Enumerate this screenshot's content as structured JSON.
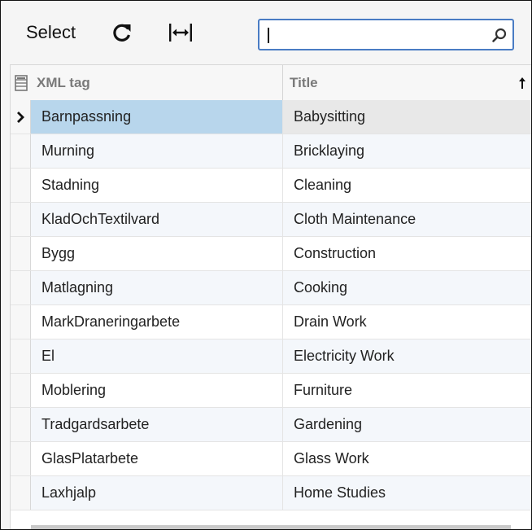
{
  "toolbar": {
    "select_label": "Select",
    "refresh_icon": "refresh-icon",
    "fit_columns_icon": "fit-columns-icon"
  },
  "search": {
    "value": "",
    "placeholder": "",
    "icon": "search-icon",
    "border_color": "#4a7cc4"
  },
  "grid": {
    "columns": [
      {
        "key": "xml_tag",
        "label": "XML tag"
      },
      {
        "key": "title",
        "label": "Title",
        "sorted": "ascending"
      }
    ],
    "column_chooser_icon": "column-chooser-icon",
    "selected_row": 0,
    "selection_color": "#b8d6ec",
    "rows": [
      {
        "xml_tag": "Barnpassning",
        "title": "Babysitting"
      },
      {
        "xml_tag": "Murning",
        "title": "Bricklaying"
      },
      {
        "xml_tag": "Stadning",
        "title": "Cleaning"
      },
      {
        "xml_tag": "KladOchTextilvard",
        "title": "Cloth Maintenance"
      },
      {
        "xml_tag": "Bygg",
        "title": "Construction"
      },
      {
        "xml_tag": "Matlagning",
        "title": "Cooking"
      },
      {
        "xml_tag": "MarkDraneringarbete",
        "title": "Drain Work"
      },
      {
        "xml_tag": "El",
        "title": "Electricity Work"
      },
      {
        "xml_tag": "Moblering",
        "title": "Furniture"
      },
      {
        "xml_tag": "Tradgardsarbete",
        "title": "Gardening"
      },
      {
        "xml_tag": "GlasPlatarbete",
        "title": "Glass Work"
      },
      {
        "xml_tag": "Laxhjalp",
        "title": "Home Studies"
      }
    ]
  }
}
